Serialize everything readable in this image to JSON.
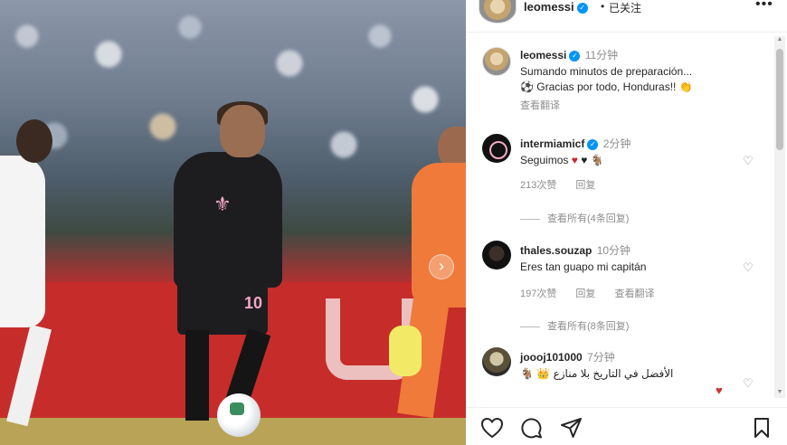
{
  "header": {
    "username": "leomessi",
    "separator": "•",
    "follow_label": "已关注",
    "more_label": "•••"
  },
  "post": {
    "username": "leomessi",
    "time": "11分钟",
    "caption_line1": "Sumando minutos de preparación...",
    "caption_line2": "Gracias por todo, Honduras!!",
    "translate_label": "查看翻译"
  },
  "comments": [
    {
      "username": "intermiamicf",
      "time": "2分钟",
      "text": "Seguimos",
      "likes": "213次赞",
      "reply_label": "回复",
      "view_replies": "查看所有(4条回复)"
    },
    {
      "username": "thales.souzap",
      "time": "10分钟",
      "text": "Eres tan guapo mi capitán",
      "likes": "197次赞",
      "reply_label": "回复",
      "translate_label": "查看翻译",
      "view_replies": "查看所有(8条回复)"
    },
    {
      "username": "joooj101000",
      "time": "7分钟",
      "text": "الأفضل في التاريخ بلا منازع"
    }
  ],
  "icons": {
    "verified": "verified-badge-icon",
    "like": "heart-icon",
    "comment": "comment-icon",
    "share": "send-icon",
    "save": "bookmark-icon",
    "next": "chevron-right-icon"
  },
  "colors": {
    "verified": "#0095f6",
    "like_active": "#d32f2f",
    "muted_text": "#8e8e8e"
  }
}
